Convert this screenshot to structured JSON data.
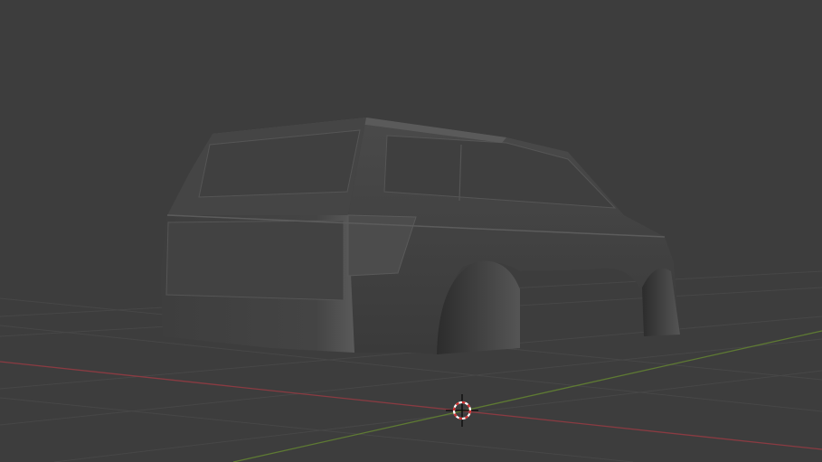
{
  "viewport": {
    "background_color": "#3d3d3d",
    "grid_color": "#474747",
    "x_axis_color": "#8a3b42",
    "y_axis_color": "#5e7a33",
    "model_color": "#474747",
    "cursor_icon": "3d-cursor-icon"
  }
}
